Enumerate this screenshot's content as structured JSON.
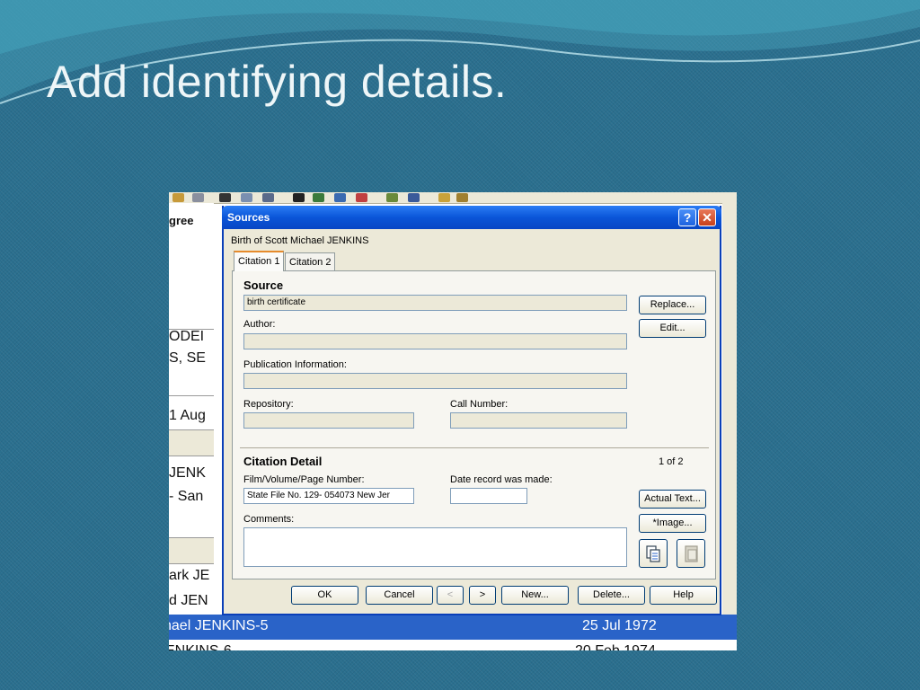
{
  "slide": {
    "title": "Add identifying details."
  },
  "background_app": {
    "col_snippets": [
      "gree",
      "ODEI",
      "S, SE",
      "1 Aug",
      "JENK",
      "- San",
      "ark JE",
      "d JEN"
    ],
    "selected_row": {
      "name": "hael JENKINS-5",
      "date": "25 Jul 1972"
    },
    "last_row": {
      "name": "ENKINS-6",
      "date": "20 Feb 1974"
    }
  },
  "dialog": {
    "title": "Sources",
    "help_glyph": "?",
    "close_glyph": "✕",
    "event": "Birth of Scott Michael JENKINS",
    "tabs": [
      "Citation 1",
      "Citation 2"
    ],
    "source": {
      "heading": "Source",
      "title_value": "birth certificate",
      "author_label": "Author:",
      "author_value": "",
      "publication_label": "Publication Information:",
      "publication_value": "",
      "repository_label": "Repository:",
      "repository_value": "",
      "call_number_label": "Call Number:",
      "call_number_value": "",
      "replace_button": "Replace...",
      "edit_button": "Edit..."
    },
    "citation": {
      "heading": "Citation Detail",
      "counter": "1 of 2",
      "film_label": "Film/Volume/Page Number:",
      "film_value": "State File No. 129-     054073 New Jer",
      "date_label": "Date record was made:",
      "date_value": "",
      "comments_label": "Comments:",
      "comments_value": "",
      "actual_text_button": "Actual Text...",
      "image_button": "*Image..."
    },
    "footer": {
      "ok": "OK",
      "cancel": "Cancel",
      "prev": "<",
      "next": ">",
      "new": "New...",
      "delete": "Delete...",
      "help": "Help"
    }
  },
  "colors": {
    "titlebar": "#0a55d8",
    "dialog_bg": "#ece9d8",
    "selected_row": "#2a63c8",
    "slide_bg": "#2a6f8e"
  }
}
